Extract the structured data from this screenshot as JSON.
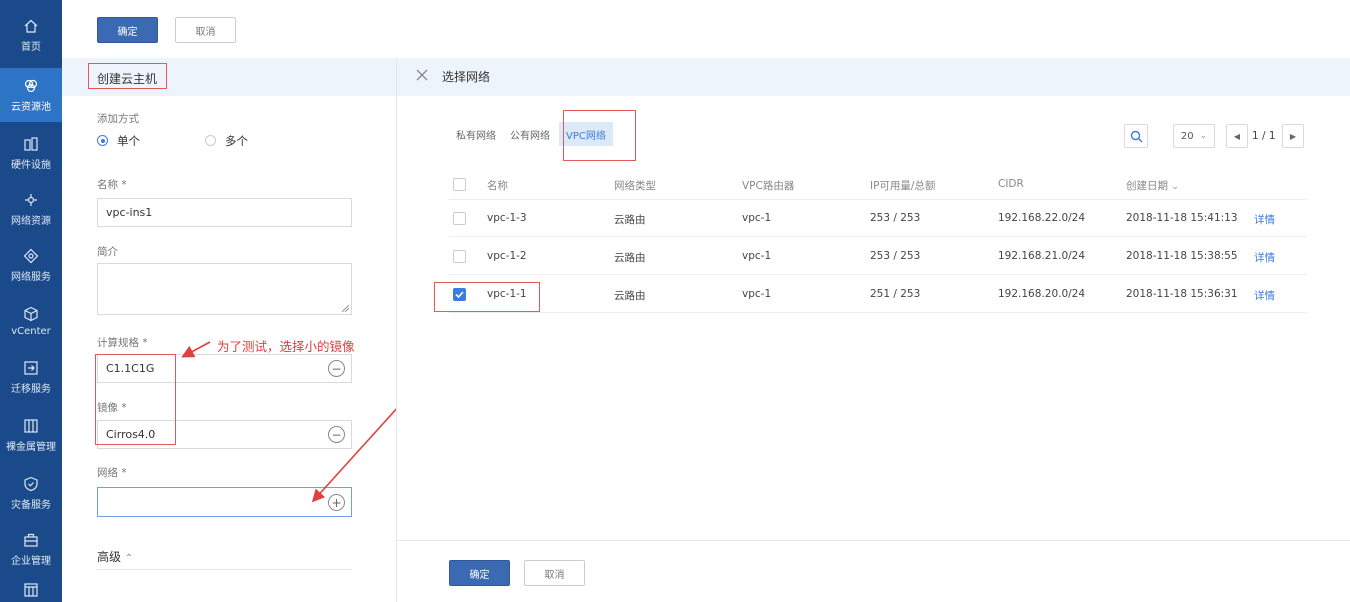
{
  "sidebar": {
    "items": [
      {
        "label": "首页",
        "icon": "home-icon"
      },
      {
        "label": "云资源池",
        "icon": "cloud-pool-icon"
      },
      {
        "label": "硬件设施",
        "icon": "hardware-icon"
      },
      {
        "label": "网络资源",
        "icon": "network-resource-icon"
      },
      {
        "label": "网络服务",
        "icon": "network-service-icon"
      },
      {
        "label": "vCenter",
        "icon": "vcenter-icon"
      },
      {
        "label": "迁移服务",
        "icon": "migration-icon"
      },
      {
        "label": "裸金属管理",
        "icon": "bare-metal-icon"
      },
      {
        "label": "灾备服务",
        "icon": "disaster-recovery-icon"
      },
      {
        "label": "企业管理",
        "icon": "enterprise-icon"
      }
    ],
    "active_index": 1
  },
  "topbar": {
    "confirm_label": "确定",
    "cancel_label": "取消"
  },
  "form": {
    "title": "创建云主机",
    "add_mode_label": "添加方式",
    "mode_single": "单个",
    "mode_multi": "多个",
    "name_label": "名称 *",
    "name_value": "vpc-ins1",
    "desc_label": "简介",
    "spec_label": "计算规格 *",
    "spec_value": "C1.1C1G",
    "image_label": "镜像 *",
    "image_value": "Cirros4.0",
    "network_label": "网络 *",
    "network_value": "",
    "advanced_label": "高级",
    "annotation": "为了测试，选择小的镜像"
  },
  "network_panel": {
    "title": "选择网络",
    "tabs": [
      "私有网络",
      "公有网络",
      "VPC网络"
    ],
    "active_tab": 2,
    "page_size": "20",
    "page_info": "1 / 1",
    "columns": [
      "名称",
      "网络类型",
      "VPC路由器",
      "IP可用量/总额",
      "CIDR",
      "创建日期"
    ],
    "rows": [
      {
        "name": "vpc-1-3",
        "type": "云路由",
        "router": "vpc-1",
        "ip": "253 / 253",
        "cidr": "192.168.22.0/24",
        "date": "2018-11-18 15:41:13",
        "action": "详情",
        "checked": false
      },
      {
        "name": "vpc-1-2",
        "type": "云路由",
        "router": "vpc-1",
        "ip": "253 / 253",
        "cidr": "192.168.21.0/24",
        "date": "2018-11-18 15:38:55",
        "action": "详情",
        "checked": false
      },
      {
        "name": "vpc-1-1",
        "type": "云路由",
        "router": "vpc-1",
        "ip": "251 / 253",
        "cidr": "192.168.20.0/24",
        "date": "2018-11-18 15:36:31",
        "action": "详情",
        "checked": true
      }
    ],
    "confirm_label": "确定",
    "cancel_label": "取消"
  },
  "colors": {
    "sidebar": "#1b4a8a",
    "sidebar_active": "#2d73c6",
    "primary": "#3c6ab2",
    "link": "#3c7be0",
    "annotation": "#e04040"
  }
}
